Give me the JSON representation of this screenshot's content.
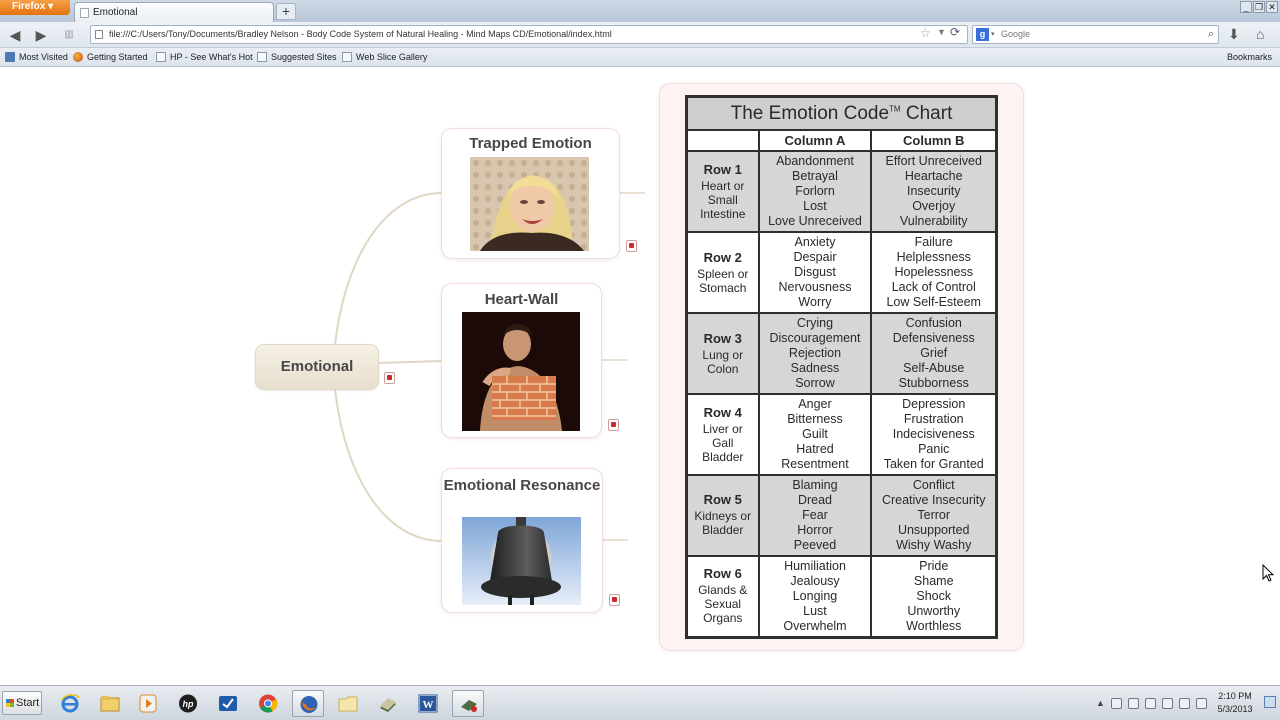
{
  "browser": {
    "menu_label": "Firefox",
    "tab_title": "Emotional",
    "newtab_label": "+",
    "url": "file:///C:/Users/Tony/Documents/Bradley Nelson - Body Code System of Natural Healing - Mind Maps CD/Emotional/index.html",
    "search_placeholder": "Google",
    "window_controls": [
      "_",
      "❐",
      "✕"
    ],
    "bookmarks": [
      {
        "label": "Most Visited",
        "icon": "bookmark-icon"
      },
      {
        "label": "Getting Started",
        "icon": "firefox-icon"
      },
      {
        "label": "HP - See What's Hot",
        "icon": "page-icon"
      },
      {
        "label": "Suggested Sites",
        "icon": "page-icon"
      },
      {
        "label": "Web Slice Gallery",
        "icon": "page-icon"
      }
    ],
    "bookmarks_menu": "Bookmarks"
  },
  "mindmap": {
    "central": "Emotional",
    "branches": [
      {
        "title": "Trapped Emotion",
        "image": "crying-woman-photo"
      },
      {
        "title": "Heart-Wall",
        "image": "man-with-brick-wall-photo"
      },
      {
        "title": "Emotional Resonance",
        "image": "bell-photo"
      }
    ]
  },
  "emotion_chart": {
    "title": "The Emotion Code",
    "trademark": "TM",
    "title_suffix": "Chart",
    "columns": [
      "Column A",
      "Column B"
    ],
    "rows": [
      {
        "name": "Row 1",
        "organs": [
          "Heart or",
          "Small",
          "Intestine"
        ],
        "column_a": [
          "Abandonment",
          "Betrayal",
          "Forlorn",
          "Lost",
          "Love Unreceived"
        ],
        "column_b": [
          "Effort Unreceived",
          "Heartache",
          "Insecurity",
          "Overjoy",
          "Vulnerability"
        ]
      },
      {
        "name": "Row 2",
        "organs": [
          "Spleen or",
          "Stomach"
        ],
        "column_a": [
          "Anxiety",
          "Despair",
          "Disgust",
          "Nervousness",
          "Worry"
        ],
        "column_b": [
          "Failure",
          "Helplessness",
          "Hopelessness",
          "Lack of Control",
          "Low Self-Esteem"
        ]
      },
      {
        "name": "Row 3",
        "organs": [
          "Lung or",
          "Colon"
        ],
        "column_a": [
          "Crying",
          "Discouragement",
          "Rejection",
          "Sadness",
          "Sorrow"
        ],
        "column_b": [
          "Confusion",
          "Defensiveness",
          "Grief",
          "Self-Abuse",
          "Stubborness"
        ]
      },
      {
        "name": "Row 4",
        "organs": [
          "Liver or",
          "Gall",
          "Bladder"
        ],
        "column_a": [
          "Anger",
          "Bitterness",
          "Guilt",
          "Hatred",
          "Resentment"
        ],
        "column_b": [
          "Depression",
          "Frustration",
          "Indecisiveness",
          "Panic",
          "Taken for Granted"
        ]
      },
      {
        "name": "Row 5",
        "organs": [
          "Kidneys or",
          "Bladder"
        ],
        "column_a": [
          "Blaming",
          "Dread",
          "Fear",
          "Horror",
          "Peeved"
        ],
        "column_b": [
          "Conflict",
          "Creative Insecurity",
          "Terror",
          "Unsupported",
          "Wishy Washy"
        ]
      },
      {
        "name": "Row 6",
        "organs": [
          "Glands &",
          "Sexual",
          "Organs"
        ],
        "column_a": [
          "Humiliation",
          "Jealousy",
          "Longing",
          "Lust",
          "Overwhelm"
        ],
        "column_b": [
          "Pride",
          "Shame",
          "Shock",
          "Unworthy",
          "Worthless"
        ]
      }
    ]
  },
  "taskbar": {
    "start_label": "Start",
    "apps": [
      "internet-explorer-icon",
      "file-explorer-icon",
      "media-player-icon",
      "hp-icon",
      "checkmark-app-icon",
      "chrome-icon",
      "firefox-icon",
      "folder-icon",
      "book-app-icon",
      "word-icon",
      "mindmap-app-icon"
    ],
    "time": "2:10 PM",
    "date": "5/3/2013"
  }
}
